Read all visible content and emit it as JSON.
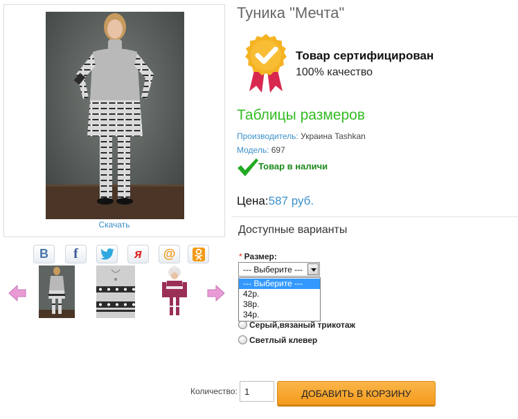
{
  "product": {
    "title": "Туника \"Мечта\"",
    "download_link": "Скачать"
  },
  "certification": {
    "title": "Товар сертифицирован",
    "subtitle": "100% качество",
    "badge_color": "#f5b324",
    "ribbon_color": "#d8284f"
  },
  "size_table_link": "Таблицы размеров",
  "meta": {
    "manufacturer_label": "Производитель:",
    "manufacturer_value": "Украина Tashkan",
    "model_label": "Модель:",
    "model_value": "697"
  },
  "stock": {
    "text": "Товар в наличи",
    "icon": "check-icon",
    "color": "#22aa22"
  },
  "price": {
    "label": "Цена:",
    "value": "587 руб."
  },
  "variants": {
    "title": "Доступные варианты",
    "size_label": "Размер:",
    "required_mark": "*",
    "select_value": "--- Выберите ---",
    "options": [
      "--- Выберите ---",
      "42р.",
      "38р.",
      "34р."
    ],
    "color_options": [
      "Серый,вязаный трикотаж",
      "Светлый клевер"
    ]
  },
  "social": [
    {
      "name": "vkontakte-icon",
      "glyph": "В",
      "color": "#4a76a8"
    },
    {
      "name": "facebook-icon",
      "glyph": "f",
      "color": "#3b5998"
    },
    {
      "name": "twitter-icon",
      "glyph": "",
      "color": "#2fa8e0"
    },
    {
      "name": "yaru-icon",
      "glyph": "я",
      "color": "#e02020"
    },
    {
      "name": "mailru-icon",
      "glyph": "@",
      "color": "#f39a16"
    },
    {
      "name": "odnoklassniki-icon",
      "glyph": "",
      "color": "#f39a16"
    }
  ],
  "cart": {
    "quantity_label": "Количество:",
    "quantity_value": "1",
    "add_button": "ДОБАВИТЬ В КОРЗИНУ"
  },
  "colors": {
    "accent_blue": "#3a8fc9",
    "accent_green": "#33bb22",
    "button_orange": "#f7a52a"
  }
}
